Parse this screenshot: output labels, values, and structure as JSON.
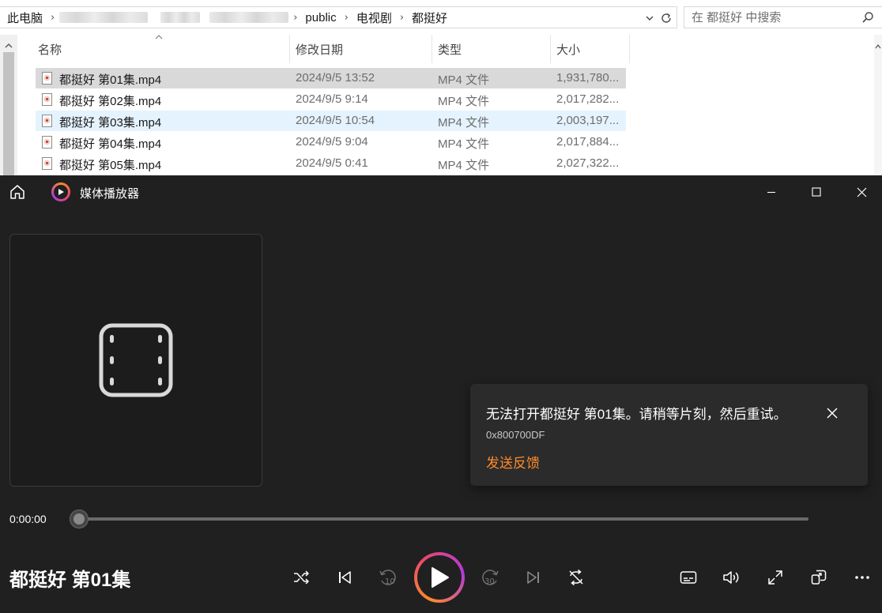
{
  "explorer": {
    "breadcrumb": {
      "root": "此电脑",
      "items": [
        "public",
        "电视剧",
        "都挺好"
      ]
    },
    "search_placeholder": "在 都挺好 中搜索",
    "columns": [
      "名称",
      "修改日期",
      "类型",
      "大小"
    ],
    "files": [
      {
        "name": "都挺好 第01集.mp4",
        "date": "2024/9/5 13:52",
        "type": "MP4 文件",
        "size": "1,931,780..."
      },
      {
        "name": "都挺好 第02集.mp4",
        "date": "2024/9/5 9:14",
        "type": "MP4 文件",
        "size": "2,017,282..."
      },
      {
        "name": "都挺好 第03集.mp4",
        "date": "2024/9/5 10:54",
        "type": "MP4 文件",
        "size": "2,003,197..."
      },
      {
        "name": "都挺好 第04集.mp4",
        "date": "2024/9/5 9:04",
        "type": "MP4 文件",
        "size": "2,017,884..."
      },
      {
        "name": "都挺好 第05集.mp4",
        "date": "2024/9/5 0:41",
        "type": "MP4 文件",
        "size": "2,027,322..."
      }
    ]
  },
  "player": {
    "app_title": "媒体播放器",
    "error": {
      "message": "无法打开都挺好 第01集。请稍等片刻，然后重试。",
      "code": "0x800700DF",
      "feedback_link": "发送反馈"
    },
    "current_time": "0:00:00",
    "progress": 0,
    "now_playing_title": "都挺好 第01集",
    "skip_back_seconds": "10",
    "skip_forward_seconds": "30",
    "accent_color": "#ff8a2b"
  }
}
